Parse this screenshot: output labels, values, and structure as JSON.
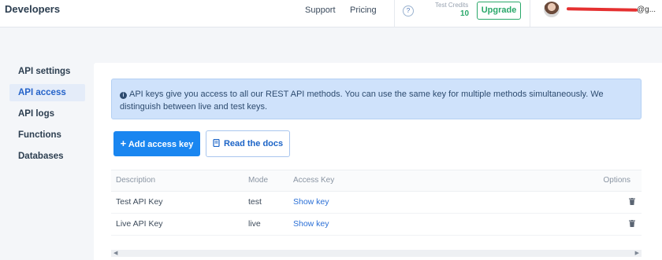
{
  "header": {
    "brand": "Developers",
    "nav": [
      "Support",
      "Pricing"
    ],
    "help_icon": "question-circle-icon",
    "credits_label": "Test Credits",
    "credits_value": "10",
    "upgrade_label": "Upgrade",
    "user_email": "@g..."
  },
  "sidebar": {
    "items": [
      {
        "label": "API settings",
        "active": false
      },
      {
        "label": "API access",
        "active": true
      },
      {
        "label": "API logs",
        "active": false
      },
      {
        "label": "Functions",
        "active": false
      },
      {
        "label": "Databases",
        "active": false
      }
    ]
  },
  "main": {
    "info_text": "API keys give you access to all our REST API methods. You can use the same key for multiple methods simultaneously. We distinguish between live and test keys.",
    "add_key_label": "Add access key",
    "docs_label": "Read the docs",
    "table": {
      "columns": [
        "Description",
        "Mode",
        "Access Key",
        "Options"
      ],
      "rows": [
        {
          "description": "Test API Key",
          "mode": "test",
          "access_key": "Show key",
          "option_icon": "trash-icon"
        },
        {
          "description": "Live API Key",
          "mode": "live",
          "access_key": "Show key",
          "option_icon": "trash-icon"
        }
      ]
    }
  },
  "colors": {
    "accent": "#1a86f0",
    "success": "#2aa86a",
    "info_bg": "#cfe2fb"
  }
}
